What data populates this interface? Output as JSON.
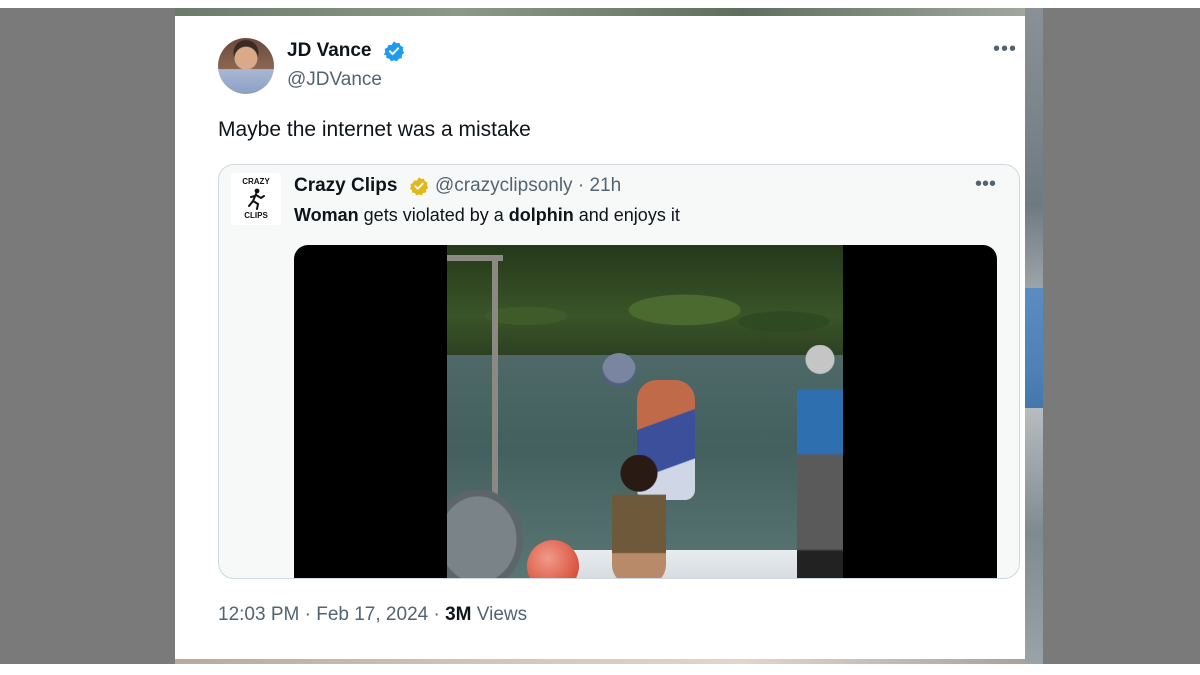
{
  "tweet": {
    "author_name": "JD Vance",
    "author_handle": "@JDVance",
    "text": "Maybe the internet was a mistake",
    "time": "12:03 PM",
    "date": "Feb 17, 2024",
    "views_count": "3M",
    "views_label": "Views",
    "more_icon": "more-horizontal-icon",
    "verified_color": "#1d9bf0"
  },
  "quote": {
    "logo_top": "CRAZY",
    "logo_bottom": "CLIPS",
    "author_name": "Crazy Clips",
    "author_handle": "@crazyclipsonly",
    "age": "21h",
    "text_parts": [
      "Woman",
      " gets violated by a ",
      "dolphin",
      " and enjoys it"
    ],
    "verified_color": "#e2b719"
  }
}
